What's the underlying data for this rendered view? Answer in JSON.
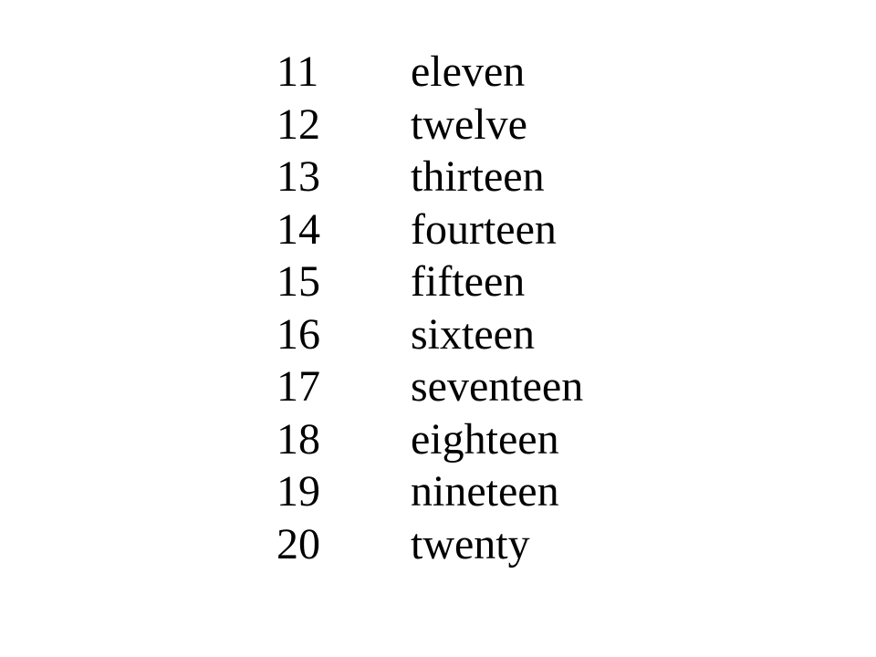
{
  "page": {
    "background_color": "#ffffff",
    "text_color": "#000000"
  },
  "number_list": {
    "rows": [
      {
        "numeral": "11",
        "word": "eleven"
      },
      {
        "numeral": "12",
        "word": "twelve"
      },
      {
        "numeral": "13",
        "word": "thirteen"
      },
      {
        "numeral": "14",
        "word": "fourteen"
      },
      {
        "numeral": "15",
        "word": "fifteen"
      },
      {
        "numeral": "16",
        "word": "sixteen"
      },
      {
        "numeral": "17",
        "word": "seventeen"
      },
      {
        "numeral": "18",
        "word": "eighteen"
      },
      {
        "numeral": "19",
        "word": "nineteen"
      },
      {
        "numeral": "20",
        "word": "twenty"
      }
    ]
  }
}
